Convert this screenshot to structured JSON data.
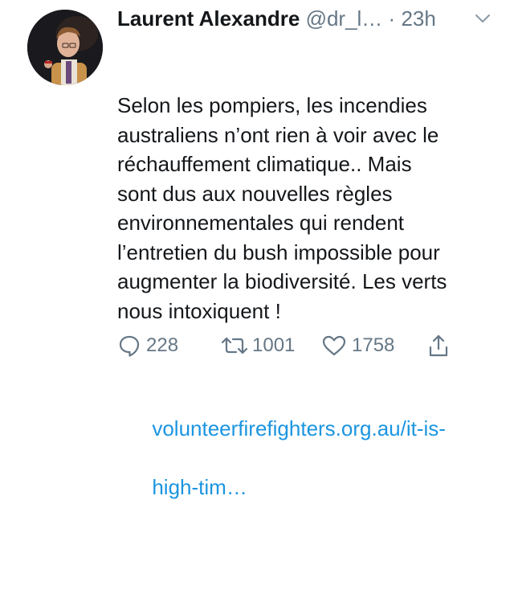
{
  "tweet": {
    "author_name": "Laurent Alexandre",
    "handle": "@dr_l…",
    "separator": "·",
    "time": "23h",
    "text": "Selon les pompiers, les incendies\naustraliens n’ont rien à voir avec le\nréchauffement climatique.. Mais\nsont dus aux nouvelles règles\nenvironnementales qui rendent\nl’entretien du bush impossible pour\naugmenter la biodiversité. Les verts\nnous intoxiquent !",
    "link_line1": "volunteerfirefighters.org.au/it-is-",
    "link_line2": "high-tim…",
    "actions": {
      "replies": "228",
      "retweets": "1001",
      "likes": "1758"
    }
  },
  "colors": {
    "text": "#14171a",
    "secondary": "#657786",
    "link": "#1b95e0"
  },
  "icons": [
    "chevron-down-icon",
    "reply-icon",
    "retweet-icon",
    "heart-icon",
    "share-icon"
  ]
}
